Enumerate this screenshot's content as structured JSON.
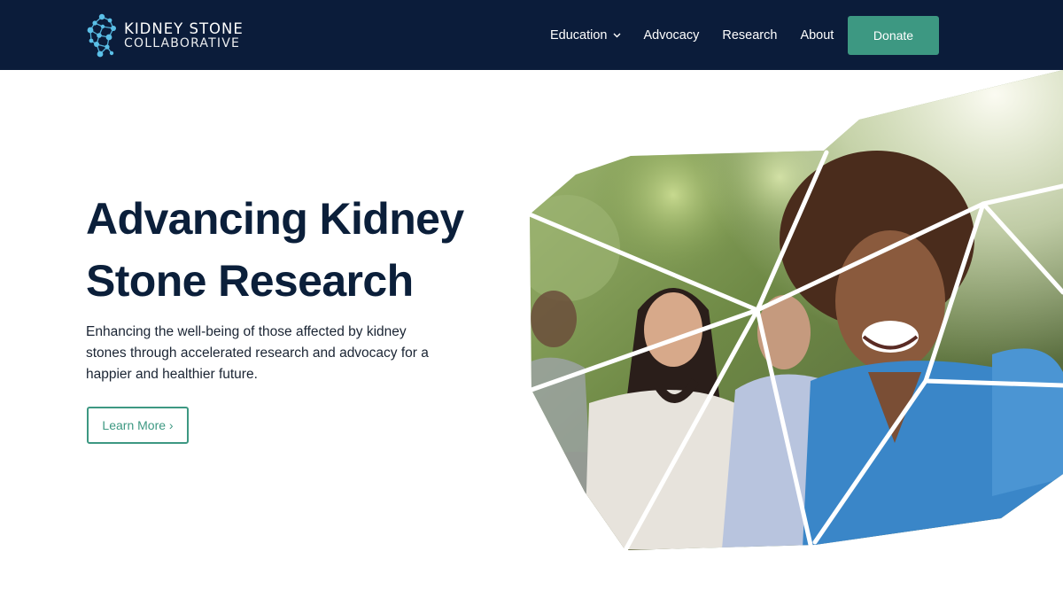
{
  "header": {
    "logo": {
      "line1": "KIDNEY STONE",
      "line2": "COLLABORATIVE",
      "icon": "molecule-network-icon"
    },
    "nav": [
      {
        "label": "Education",
        "has_dropdown": true
      },
      {
        "label": "Advocacy"
      },
      {
        "label": "Research"
      },
      {
        "label": "About"
      }
    ],
    "donate_label": "Donate"
  },
  "hero": {
    "title_line1": "Advancing Kidney",
    "title_line2": "Stone Research",
    "subtitle": "Enhancing the well-being of those affected by kidney stones through accelerated research and advocacy for a happier and healthier future.",
    "cta_label": "Learn More ›",
    "image_alt_icon": "hero-photo-people-laughing"
  },
  "colors": {
    "header_bg": "#0b1c3a",
    "accent_green": "#3d9882",
    "logo_blue": "#5bc0e8",
    "heading": "#0b1f3a"
  }
}
